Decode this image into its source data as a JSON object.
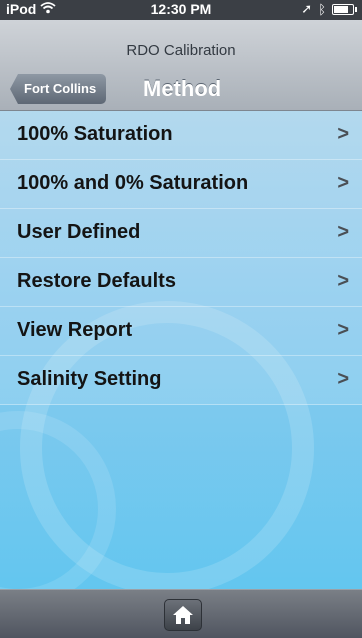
{
  "status_bar": {
    "carrier": "iPod",
    "wifi_icon": "wifi-icon",
    "time": "12:30 PM",
    "location_icon": "location-arrow-icon",
    "bluetooth_icon": "bluetooth-icon",
    "battery_icon": "battery-icon"
  },
  "nav": {
    "subtitle": "RDO Calibration",
    "back_label": "Fort Collins",
    "title": "Method"
  },
  "menu": {
    "items": [
      {
        "label": "100% Saturation"
      },
      {
        "label": "100% and 0% Saturation"
      },
      {
        "label": "User Defined"
      },
      {
        "label": "Restore Defaults"
      },
      {
        "label": "View Report"
      },
      {
        "label": "Salinity Setting"
      }
    ],
    "chevron": ">"
  },
  "tab_bar": {
    "home_icon": "home-icon"
  },
  "colors": {
    "status_bg": "#3b3f45",
    "content_top": "#a9d4ec",
    "content_bottom": "#63c6ef",
    "tab_bar": "#505560"
  }
}
